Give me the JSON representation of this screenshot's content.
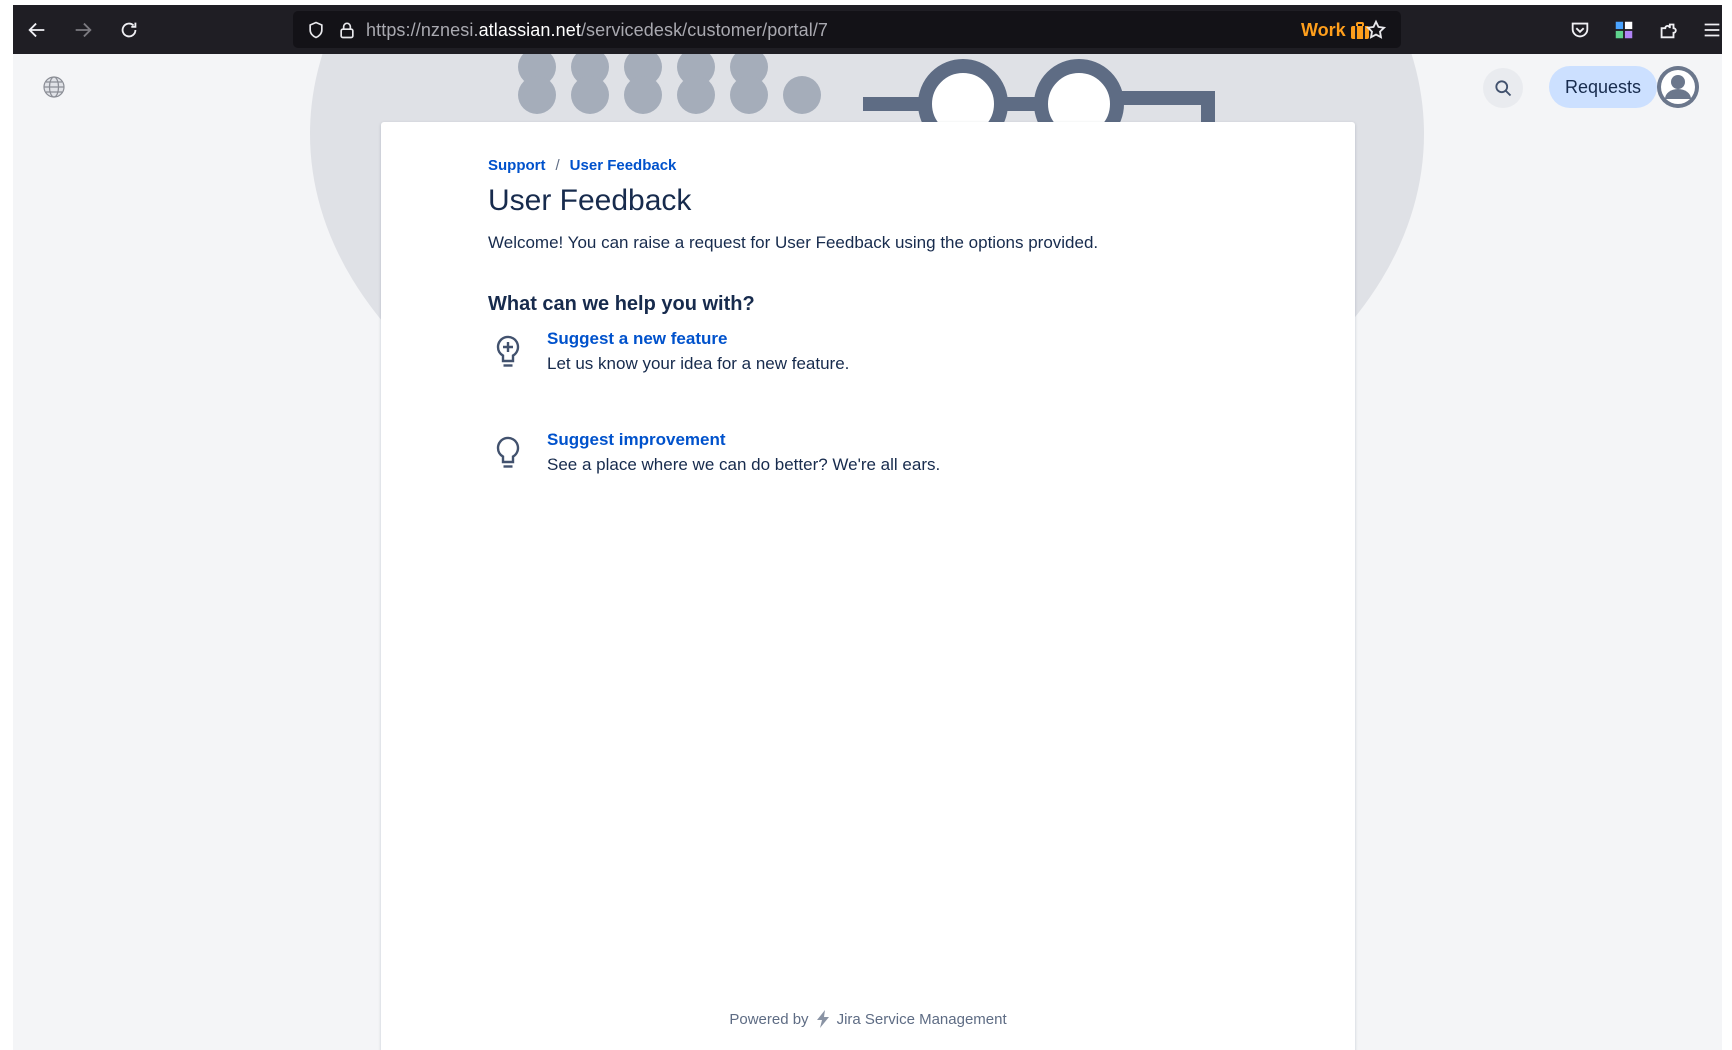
{
  "browser": {
    "url_prefix": "https://nznesi.",
    "url_host": "atlassian.net",
    "url_path": "/servicedesk/customer/portal/7",
    "container_label": "Work",
    "colors": {
      "toolbar": "#1f1e24",
      "container_accent": "#ff9f1c"
    }
  },
  "header": {
    "requests_label": "Requests"
  },
  "breadcrumb": {
    "items": [
      "Support",
      "User Feedback"
    ],
    "separator": "/"
  },
  "portal": {
    "title": "User Feedback",
    "welcome": "Welcome! You can raise a request for User Feedback using the options provided.",
    "help_heading": "What can we help you with?"
  },
  "request_types": [
    {
      "icon": "lightbulb-plus-icon",
      "title": "Suggest a new feature",
      "description": "Let us know your idea for a new feature."
    },
    {
      "icon": "lightbulb-icon",
      "title": "Suggest improvement",
      "description": "See a place where we can do better? We're all ears."
    }
  ],
  "footer": {
    "powered_prefix": "Powered by",
    "product": "Jira Service Management"
  },
  "colors": {
    "link": "#0052cc",
    "text": "#172b4d",
    "requests_button_bg": "#cce0ff"
  }
}
